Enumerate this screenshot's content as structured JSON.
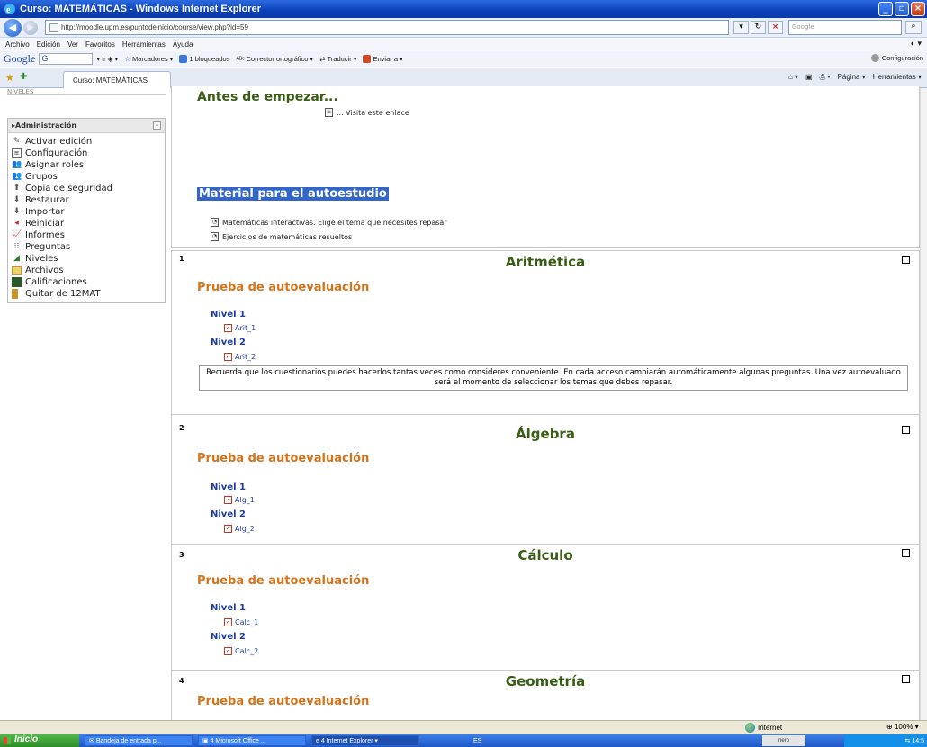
{
  "window": {
    "title": "Curso: MATEMÁTICAS - Windows Internet Explorer"
  },
  "address": {
    "url": "http://moodle.upm.es/puntodeinicio/course/view.php?id=59",
    "search_placeholder": "Google"
  },
  "menu": [
    "Archivo",
    "Edición",
    "Ver",
    "Favoritos",
    "Herramientas",
    "Ayuda"
  ],
  "google_toolbar": {
    "logo": "Google",
    "g_label": "G",
    "ir": "Ir",
    "marcadores": "Marcadores",
    "bloqueados": "1 bloqueados",
    "corrector": "Corrector ortográfico",
    "traducir": "Traducir",
    "enviar": "Enviar a",
    "configuracion": "Configuración"
  },
  "tab": {
    "title": "Curso: MATEMÁTICAS"
  },
  "command_bar": {
    "pagina": "Página",
    "herramientas": "Herramientas"
  },
  "sidebar": {
    "top_cut": "NIVELES",
    "admin_title": "Administración",
    "items": [
      {
        "label": "Activar edición",
        "icon": "pencil-icon"
      },
      {
        "label": "Configuración",
        "icon": "settings-icon"
      },
      {
        "label": "Asignar roles",
        "icon": "roles-icon"
      },
      {
        "label": "Grupos",
        "icon": "groups-icon"
      },
      {
        "label": "Copia de seguridad",
        "icon": "backup-icon"
      },
      {
        "label": "Restaurar",
        "icon": "restore-icon"
      },
      {
        "label": "Importar",
        "icon": "import-icon"
      },
      {
        "label": "Reiniciar",
        "icon": "reset-icon"
      },
      {
        "label": "Informes",
        "icon": "reports-icon"
      },
      {
        "label": "Preguntas",
        "icon": "questions-icon"
      },
      {
        "label": "Niveles",
        "icon": "levels-icon"
      },
      {
        "label": "Archivos",
        "icon": "folder-icon"
      },
      {
        "label": "Calificaciones",
        "icon": "grades-icon"
      },
      {
        "label": "Quitar de 12MAT",
        "icon": "unenrol-icon"
      }
    ]
  },
  "section0": {
    "heading": "Antes de empezar...",
    "visit_link": "... Visita este enlace",
    "material_heading": "Material para el autoestudio",
    "links": [
      "Matemáticas interactivas. Elige el tema que necesites repasar",
      "Ejercicios de matemáticas resueltos"
    ]
  },
  "sections": [
    {
      "num": "1",
      "title": "Aritmética",
      "subtitle": "Prueba de autoevaluación",
      "level1": "Nivel 1",
      "quiz1": "Arit_1",
      "level2": "Nivel 2",
      "quiz2": "Arit_2",
      "note": "Recuerda que los cuestionarios puedes hacerlos tantas veces como consideres conveniente. En cada acceso cambiarán automáticamente algunas preguntas. Una vez autoevaluado será el momento de seleccionar los temas que debes repasar."
    },
    {
      "num": "2",
      "title": "Álgebra",
      "subtitle": "Prueba de autoevaluación",
      "level1": "Nivel 1",
      "quiz1": "Alg_1",
      "level2": "Nivel 2",
      "quiz2": "Alg_2"
    },
    {
      "num": "3",
      "title": "Cálculo",
      "subtitle": "Prueba de autoevaluación",
      "level1": "Nivel 1",
      "quiz1": "Calc_1",
      "level2": "Nivel 2",
      "quiz2": "Calc_2"
    },
    {
      "num": "4",
      "title": "Geometría",
      "subtitle": "Prueba de autoevaluación"
    }
  ],
  "statusbar": {
    "zone": "Internet",
    "zoom": "100%"
  },
  "taskbar": {
    "start": "Inicio",
    "tasks": [
      "Bandeja de entrada p...",
      "4 Microsoft Office ...",
      "4 Internet Explorer"
    ],
    "lang": "ES",
    "nero": "nero",
    "time": "14:5"
  }
}
